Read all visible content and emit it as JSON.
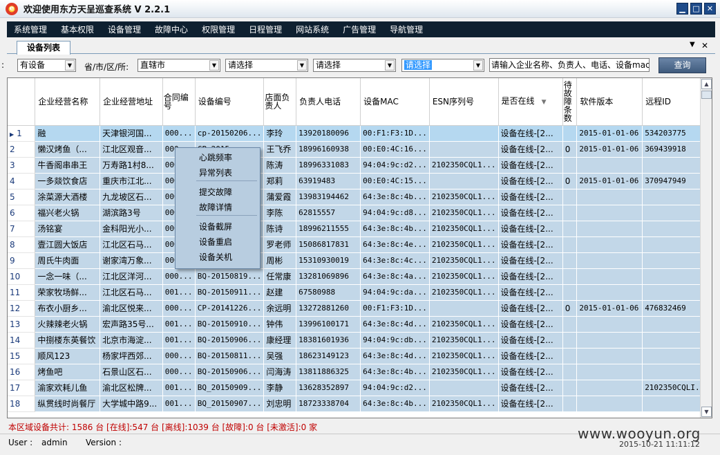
{
  "window": {
    "title": "欢迎使用东方天呈巡查系统 V 2.2.1"
  },
  "menu": [
    "系统管理",
    "基本权限",
    "设备管理",
    "故障中心",
    "权限管理",
    "日程管理",
    "网站系统",
    "广告管理",
    "导航管理"
  ],
  "tab": {
    "label": "设备列表"
  },
  "filters": {
    "cut_label": ":",
    "device_select": "有设备",
    "region_label": "省/市/区/所:",
    "province_select": "直辖市",
    "city_select": "请选择",
    "district_select": "请选择",
    "station_select": "请选择",
    "search_value": "请输入企业名称、负责人、电话、设备mac.",
    "query_button": "查询"
  },
  "grid": {
    "headers": [
      "企业经营名称",
      "企业经营地址",
      "合同编号",
      "设备编号",
      "店面负责人",
      "负责人电话",
      "设备MAC",
      "ESN序列号",
      "是否在线",
      "待故障条数",
      "软件版本",
      "远程ID"
    ],
    "rows": [
      [
        "1",
        "融",
        "天津银河国...",
        "000...",
        "cp-20150206...",
        "李玲",
        "13920180096",
        "00:F1:F3:1D...",
        "",
        "设备在线-[2...",
        "",
        "2015-01-01-06",
        "534203775"
      ],
      [
        "2",
        "懒汉烤鱼（...",
        "江北区观音...",
        "000...",
        "CP-2015...",
        "王飞乔",
        "18996160938",
        "00:E0:4C:16...",
        "",
        "设备在线-[2...",
        "0",
        "2015-01-01-06",
        "369439918"
      ],
      [
        "3",
        "牛香阁串串王",
        "万寿路1村8...",
        "000...",
        "",
        "陈涛",
        "18996331083",
        "94:04:9c:d2...",
        "2102350CQL1...",
        "设备在线-[2...",
        "",
        "",
        ""
      ],
      [
        "4",
        "一多燚饮食店",
        "重庆市江北...",
        "000...",
        "",
        "郑莉",
        "63919483",
        "00:E0:4C:15...",
        "",
        "设备在线-[2...",
        "0",
        "2015-01-01-06",
        "370947949"
      ],
      [
        "5",
        "涂菜源大酒楼",
        "九龙坡区石...",
        "000...",
        "",
        "蒲爱霞",
        "13983194462",
        "64:3e:8c:4b...",
        "2102350CQL1...",
        "设备在线-[2...",
        "",
        "",
        ""
      ],
      [
        "6",
        "福兴老火锅",
        "湖滨路3号",
        "000...",
        "",
        "李陈",
        "62815557",
        "94:04:9c:d8...",
        "2102350CQL1...",
        "设备在线-[2...",
        "",
        "",
        ""
      ],
      [
        "7",
        "汤铭宴",
        "金科阳光小...",
        "000...",
        "",
        "陈诗",
        "18996211555",
        "64:3e:8c:4b...",
        "2102350CQL1...",
        "设备在线-[2...",
        "",
        "",
        ""
      ],
      [
        "8",
        "壹江圆大饭店",
        "江北区石马...",
        "000...",
        "",
        "罗老师",
        "15086817831",
        "64:3e:8c:4e...",
        "2102350CQL1...",
        "设备在线-[2...",
        "",
        "",
        ""
      ],
      [
        "9",
        "周氏牛肉面",
        "谢家湾万象...",
        "000...",
        "",
        "周彬",
        "15310930019",
        "64:3e:8c:4c...",
        "2102350CQL1...",
        "设备在线-[2...",
        "",
        "",
        ""
      ],
      [
        "10",
        "一念一味（...",
        "江北区洋河...",
        "000...",
        "BQ-20150819...",
        "任常康",
        "13281069896",
        "64:3e:8c:4a...",
        "2102350CQL1...",
        "设备在线-[2...",
        "",
        "",
        ""
      ],
      [
        "11",
        "荣家牧场鲜...",
        "江北区石马...",
        "001...",
        "BQ-20150911...",
        "赵建",
        "67580988",
        "94:04:9c:da...",
        "2102350CQL1...",
        "设备在线-[2...",
        "",
        "",
        ""
      ],
      [
        "12",
        "布衣小厨乡...",
        "渝北区悦来...",
        "000...",
        "CP-20141226...",
        "余远明",
        "13272881260",
        "00:F1:F3:1D...",
        "",
        "设备在线-[2...",
        "0",
        "2015-01-01-06",
        "476832469"
      ],
      [
        "13",
        "火辣辣老火锅",
        "宏声路35号...",
        "001...",
        "BQ-20150910...",
        "钟伟",
        "13996100171",
        "64:3e:8c:4d...",
        "2102350CQL1...",
        "设备在线-[2...",
        "",
        "",
        ""
      ],
      [
        "14",
        "中捌楼东英餐饮",
        "北京市海淀...",
        "001...",
        "BQ-20150906...",
        "康经理",
        "18381601936",
        "94:04:9c:db...",
        "2102350CQL1...",
        "设备在线-[2...",
        "",
        "",
        ""
      ],
      [
        "15",
        "顺风123",
        "杨家坪西郊...",
        "000...",
        "BQ-20150811...",
        "吴强",
        "18623149123",
        "64:3e:8c:4d...",
        "2102350CQL1...",
        "设备在线-[2...",
        "",
        "",
        ""
      ],
      [
        "16",
        "烤鱼吧",
        "石景山区石...",
        "000...",
        "BQ-20150906...",
        "闫海涛",
        "13811886325",
        "64:3e:8c:4b...",
        "2102350CQL1...",
        "设备在线-[2...",
        "",
        "",
        ""
      ],
      [
        "17",
        "渝家欢耗儿鱼",
        "渝北区松牌...",
        "001...",
        "BQ_20150909...",
        "李静",
        "13628352897",
        "94:04:9c:d2...",
        "",
        "设备在线-[2...",
        "",
        "",
        "2102350CQLI..."
      ],
      [
        "18",
        "纵贯线时尚餐厅",
        "大学城中路9...",
        "001...",
        "BQ_20150907...",
        "刘忠明",
        "18723338704",
        "64:3e:8c:4b...",
        "2102350CQL1...",
        "设备在线-[2...",
        "",
        "",
        ""
      ]
    ]
  },
  "context_menu": [
    "心跳频率",
    "异常列表",
    "提交故障",
    "故障详情",
    "设备截屏",
    "设备重启",
    "设备关机"
  ],
  "status": {
    "summary": "本区域设备共计: 1586 台  [在线]:547 台  [离线]:1039 台  [故障]:0 台  [未激活]:0 家",
    "user_label": "User :",
    "user_value": "admin",
    "version_label": "Version :",
    "datetime": "2015-10-21 11:11:12"
  },
  "watermark": "www.wooyun.org",
  "icons": {
    "app": "app-logo-icon",
    "minimize": "minimize-icon",
    "maximize": "maximize-icon",
    "close": "close-icon",
    "dropdown": "chevron-down-icon",
    "row_pointer": "row-pointer-icon"
  },
  "colors": {
    "menubar": "#0e2030",
    "row": "#c2d7e8",
    "selected_row": "#b5d8f0",
    "status_text": "#c00000",
    "query_button": "#4f6b8f"
  }
}
